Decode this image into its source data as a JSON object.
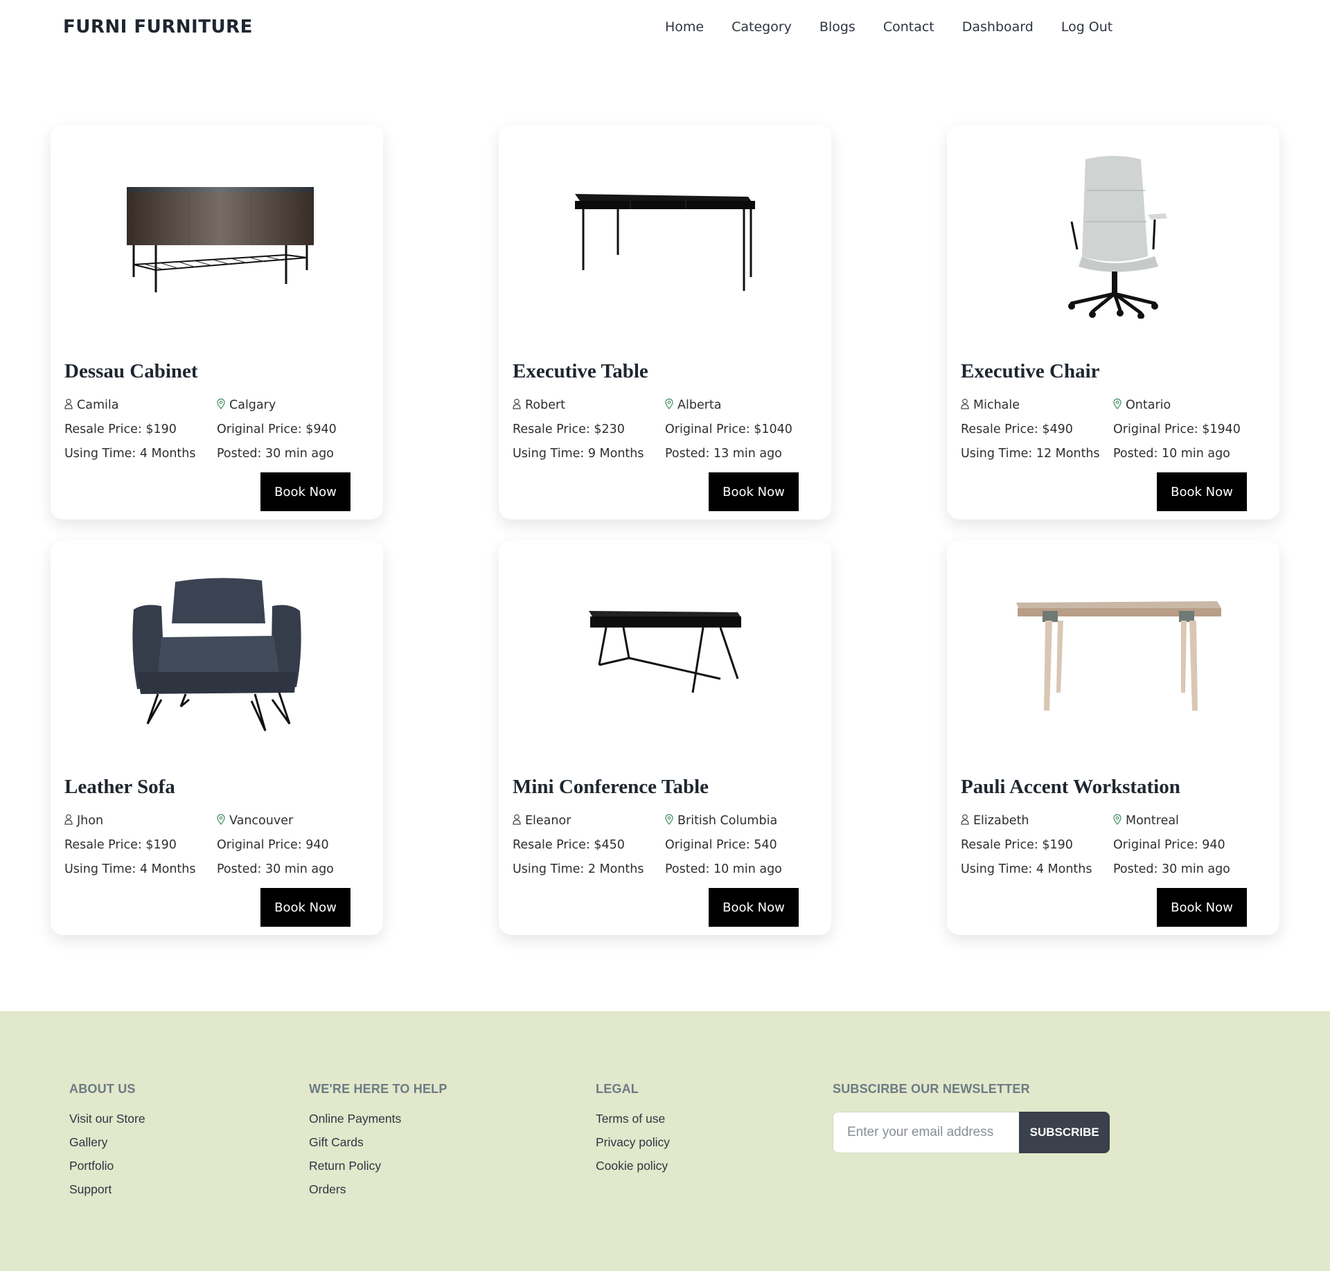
{
  "header": {
    "brand": "FURNI FURNITURE",
    "nav": [
      "Home",
      "Category",
      "Blogs",
      "Contact",
      "Dashboard",
      "Log Out"
    ]
  },
  "products": [
    {
      "title": "Dessau Cabinet",
      "seller": "Camila",
      "location": "Calgary",
      "resale": "Resale Price: $190",
      "original": "Original Price: $940",
      "using": "Using Time: 4 Months",
      "posted": "Posted: 30 min ago",
      "button": "Book Now",
      "image": "cabinet"
    },
    {
      "title": "Executive Table",
      "seller": "Robert",
      "location": "Alberta",
      "resale": "Resale Price: $230",
      "original": "Original Price: $1040",
      "using": "Using Time: 9 Months",
      "posted": "Posted: 13 min ago",
      "button": "Book Now",
      "image": "desk"
    },
    {
      "title": "Executive Chair",
      "seller": "Michale",
      "location": "Ontario",
      "resale": "Resale Price: $490",
      "original": "Original Price: $1940",
      "using": "Using Time: 12 Months",
      "posted": "Posted: 10 min ago",
      "button": "Book Now",
      "image": "office-chair"
    },
    {
      "title": "Leather Sofa",
      "seller": "Jhon",
      "location": "Vancouver",
      "resale": "Resale Price: $190",
      "original": "Original Price: 940",
      "using": "Using Time: 4 Months",
      "posted": "Posted: 30 min ago",
      "button": "Book Now",
      "image": "armchair"
    },
    {
      "title": "Mini Conference Table",
      "seller": "Eleanor",
      "location": "British Columbia",
      "resale": "Resale Price: $450",
      "original": "Original Price: 540",
      "using": "Using Time: 2 Months",
      "posted": "Posted: 10 min ago",
      "button": "Book Now",
      "image": "small-desk"
    },
    {
      "title": "Pauli Accent Workstation",
      "seller": "Elizabeth",
      "location": "Montreal",
      "resale": "Resale Price: $190",
      "original": "Original Price: 940",
      "using": "Using Time: 4 Months",
      "posted": "Posted: 30 min ago",
      "button": "Book Now",
      "image": "wood-table"
    }
  ],
  "footer": {
    "about": {
      "heading": "ABOUT US",
      "links": [
        "Visit our Store",
        "Gallery",
        "Portfolio",
        "Support"
      ]
    },
    "help": {
      "heading": "WE'RE HERE TO HELP",
      "links": [
        "Online Payments",
        "Gift Cards",
        "Return Policy",
        "Orders"
      ]
    },
    "legal": {
      "heading": "LEGAL",
      "links": [
        "Terms of use",
        "Privacy policy",
        "Cookie policy"
      ]
    },
    "newsletter": {
      "heading": "SUBSCIRBE OUR NEWSLETTER",
      "placeholder": "Enter your email address",
      "button": "SUBSCRIBE"
    }
  },
  "colors": {
    "footer_bg": "#e1e8cb",
    "button_bg": "#000000",
    "subscribe_bg": "#3a404c",
    "location_icon": "#3e8e5a"
  }
}
